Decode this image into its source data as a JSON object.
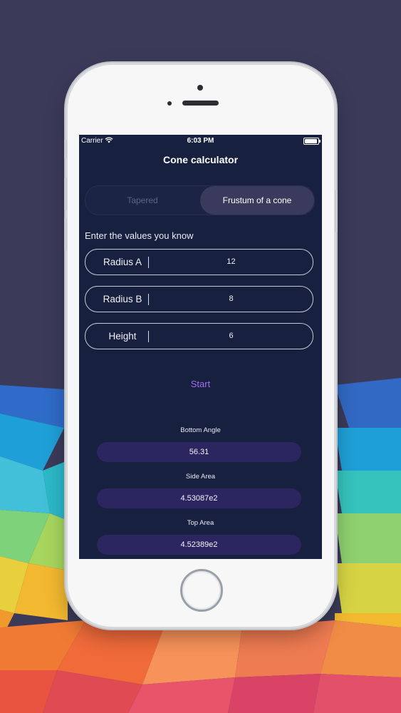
{
  "status_bar": {
    "carrier": "Carrier",
    "time": "6:03 PM"
  },
  "app": {
    "title": "Cone calculator"
  },
  "segments": {
    "left": "Tapered",
    "right": "Frustum of a cone",
    "selected": "right"
  },
  "prompt": "Enter the values you know",
  "fields": [
    {
      "label": "Radius A",
      "value": "12"
    },
    {
      "label": "Radius B",
      "value": "8"
    },
    {
      "label": "Height",
      "value": "6"
    }
  ],
  "start_label": "Start",
  "results": [
    {
      "label": "Bottom Angle",
      "value": "56.31"
    },
    {
      "label": "Side Area",
      "value": "4.53087e2"
    },
    {
      "label": "Top Area",
      "value": "4.52389e2"
    }
  ],
  "colors": {
    "screen": "#18203f",
    "accent": "#a06cf0",
    "result_pill": "#2c2660",
    "background": "#3b3a59"
  }
}
